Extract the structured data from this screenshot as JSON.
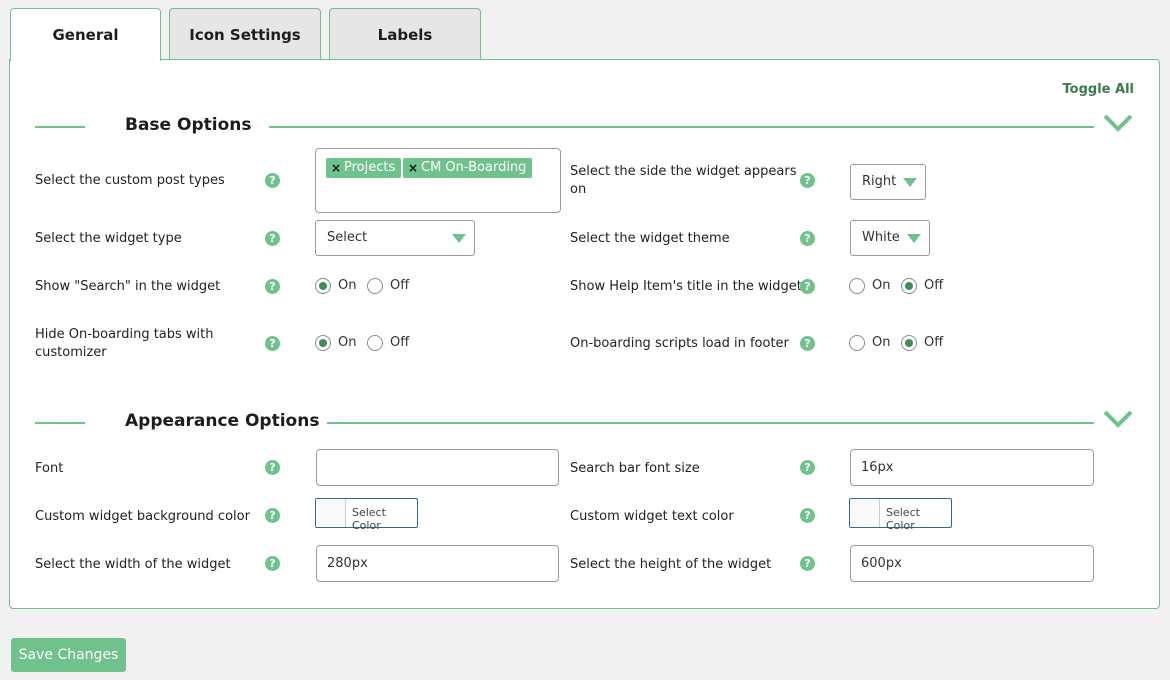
{
  "tabs": [
    {
      "label": "General",
      "active": true
    },
    {
      "label": "Icon Settings",
      "active": false
    },
    {
      "label": "Labels",
      "active": false
    }
  ],
  "toggle_all": "Toggle All",
  "base_options": {
    "title": "Base Options",
    "post_types_label": "Select the custom post types",
    "post_types_tags": [
      "Projects",
      "CM On-Boarding"
    ],
    "side_label": "Select the side the widget appears on",
    "side_value": "Right",
    "widget_type_label": "Select the widget type",
    "widget_type_value": "Select",
    "widget_theme_label": "Select the widget theme",
    "widget_theme_value": "White",
    "show_search_label": "Show \"Search\" in the widget",
    "show_search_value": "On",
    "show_help_title_label": "Show Help Item's title in the widget",
    "show_help_title_value": "Off",
    "hide_tabs_label": "Hide On-boarding tabs with customizer",
    "hide_tabs_value": "On",
    "scripts_footer_label": "On-boarding scripts load in footer",
    "scripts_footer_value": "Off",
    "on_label": "On",
    "off_label": "Off"
  },
  "appearance_options": {
    "title": "Appearance Options",
    "font_label": "Font",
    "font_value": "",
    "search_font_size_label": "Search bar font size",
    "search_font_size_value": "16px",
    "bg_color_label": "Custom widget background color",
    "text_color_label": "Custom widget text color",
    "select_color_label": "Select Color",
    "width_label": "Select the width of the widget",
    "width_value": "280px",
    "height_label": "Select the height of the widget",
    "height_value": "600px"
  },
  "help_icon_glyph": "?",
  "tag_remove_glyph": "×",
  "save_button": "Save Changes",
  "colors": {
    "accent": "#6fc28c",
    "accent_dark": "#3d7a4f",
    "radio_fill": "#3f8e5a"
  }
}
